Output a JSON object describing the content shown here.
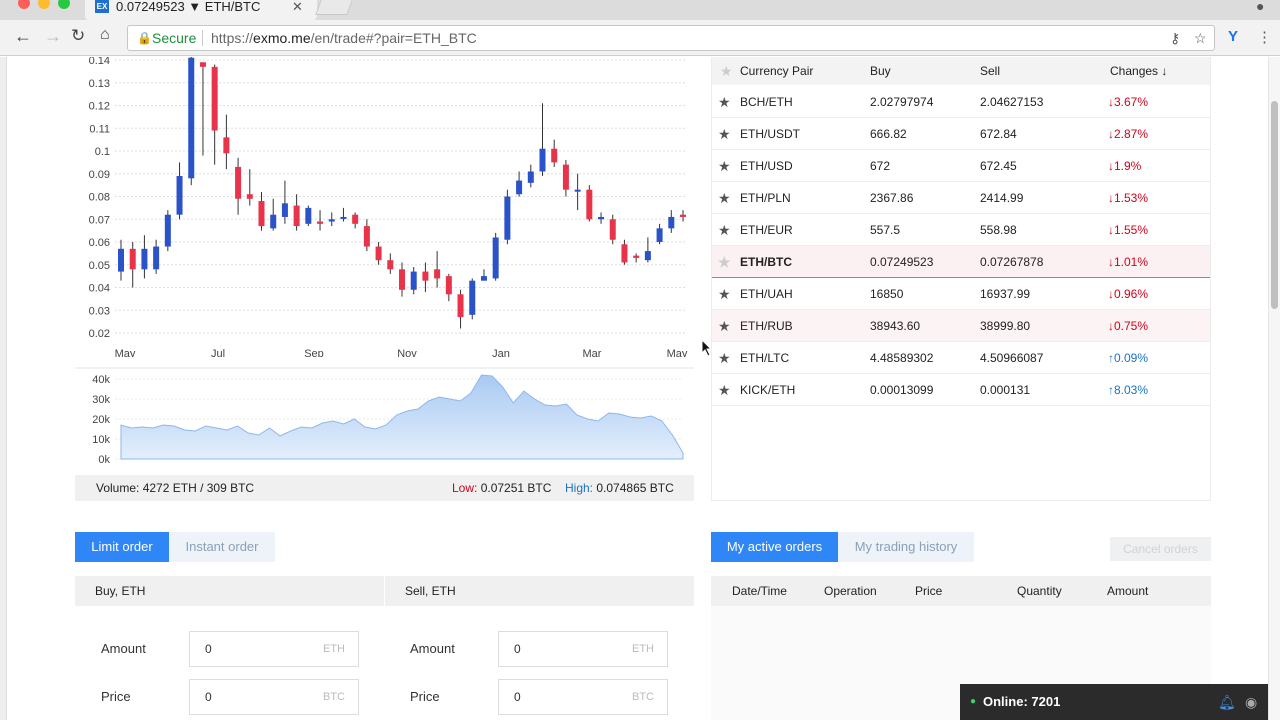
{
  "browser": {
    "tab_title": "0.07249523 ▼ ETH/BTC",
    "tab_favicon": "EX",
    "secure_label": "Secure",
    "url_scheme": "https://",
    "url_host": "exmo.me",
    "url_path": "/en/trade#?pair=ETH_BTC"
  },
  "chart_data": [
    {
      "type": "candlestick",
      "x_tick_labels": [
        "May",
        "Jul",
        "Sep",
        "Nov",
        "Jan",
        "Mar",
        "May"
      ],
      "y_tick_labels": [
        "0.14",
        "0.13",
        "0.12",
        "0.11",
        "0.1",
        "0.09",
        "0.08",
        "0.07",
        "0.06",
        "0.05",
        "0.04",
        "0.03",
        "0.02"
      ],
      "ylim": [
        0.02,
        0.14
      ],
      "grid": true,
      "up_color": "#2a52c9",
      "down_color": "#e8334a",
      "candles": [
        {
          "o": 0.047,
          "c": 0.057,
          "h": 0.061,
          "l": 0.043
        },
        {
          "o": 0.057,
          "c": 0.048,
          "h": 0.06,
          "l": 0.04
        },
        {
          "o": 0.048,
          "c": 0.057,
          "h": 0.063,
          "l": 0.044
        },
        {
          "o": 0.048,
          "c": 0.058,
          "h": 0.061,
          "l": 0.046
        },
        {
          "o": 0.058,
          "c": 0.072,
          "h": 0.074,
          "l": 0.056
        },
        {
          "o": 0.072,
          "c": 0.089,
          "h": 0.095,
          "l": 0.07
        },
        {
          "o": 0.088,
          "c": 0.141,
          "h": 0.142,
          "l": 0.085
        },
        {
          "o": 0.139,
          "c": 0.137,
          "h": 0.139,
          "l": 0.098
        },
        {
          "o": 0.137,
          "c": 0.109,
          "h": 0.138,
          "l": 0.094
        },
        {
          "o": 0.106,
          "c": 0.099,
          "h": 0.116,
          "l": 0.092
        },
        {
          "o": 0.093,
          "c": 0.079,
          "h": 0.097,
          "l": 0.072
        },
        {
          "o": 0.081,
          "c": 0.079,
          "h": 0.092,
          "l": 0.076
        },
        {
          "o": 0.078,
          "c": 0.067,
          "h": 0.082,
          "l": 0.065
        },
        {
          "o": 0.066,
          "c": 0.072,
          "h": 0.079,
          "l": 0.065
        },
        {
          "o": 0.071,
          "c": 0.077,
          "h": 0.087,
          "l": 0.068
        },
        {
          "o": 0.076,
          "c": 0.067,
          "h": 0.081,
          "l": 0.065
        },
        {
          "o": 0.068,
          "c": 0.075,
          "h": 0.076,
          "l": 0.067
        },
        {
          "o": 0.069,
          "c": 0.068,
          "h": 0.074,
          "l": 0.065
        },
        {
          "o": 0.069,
          "c": 0.07,
          "h": 0.073,
          "l": 0.067
        },
        {
          "o": 0.071,
          "c": 0.071,
          "h": 0.075,
          "l": 0.069
        },
        {
          "o": 0.072,
          "c": 0.068,
          "h": 0.073,
          "l": 0.066
        },
        {
          "o": 0.067,
          "c": 0.058,
          "h": 0.07,
          "l": 0.056
        },
        {
          "o": 0.058,
          "c": 0.052,
          "h": 0.06,
          "l": 0.05
        },
        {
          "o": 0.052,
          "c": 0.048,
          "h": 0.055,
          "l": 0.046
        },
        {
          "o": 0.048,
          "c": 0.039,
          "h": 0.051,
          "l": 0.036
        },
        {
          "o": 0.039,
          "c": 0.047,
          "h": 0.049,
          "l": 0.037
        },
        {
          "o": 0.047,
          "c": 0.043,
          "h": 0.051,
          "l": 0.038
        },
        {
          "o": 0.048,
          "c": 0.044,
          "h": 0.056,
          "l": 0.04
        },
        {
          "o": 0.045,
          "c": 0.037,
          "h": 0.046,
          "l": 0.034
        },
        {
          "o": 0.037,
          "c": 0.027,
          "h": 0.039,
          "l": 0.022
        },
        {
          "o": 0.028,
          "c": 0.043,
          "h": 0.044,
          "l": 0.026
        },
        {
          "o": 0.043,
          "c": 0.045,
          "h": 0.048,
          "l": 0.043
        },
        {
          "o": 0.044,
          "c": 0.062,
          "h": 0.064,
          "l": 0.043
        },
        {
          "o": 0.061,
          "c": 0.08,
          "h": 0.083,
          "l": 0.059
        },
        {
          "o": 0.081,
          "c": 0.087,
          "h": 0.091,
          "l": 0.08
        },
        {
          "o": 0.086,
          "c": 0.091,
          "h": 0.094,
          "l": 0.084
        },
        {
          "o": 0.091,
          "c": 0.101,
          "h": 0.121,
          "l": 0.089
        },
        {
          "o": 0.101,
          "c": 0.095,
          "h": 0.105,
          "l": 0.093
        },
        {
          "o": 0.094,
          "c": 0.083,
          "h": 0.096,
          "l": 0.08
        },
        {
          "o": 0.083,
          "c": 0.083,
          "h": 0.09,
          "l": 0.074
        },
        {
          "o": 0.083,
          "c": 0.07,
          "h": 0.085,
          "l": 0.069
        },
        {
          "o": 0.07,
          "c": 0.071,
          "h": 0.073,
          "l": 0.068
        },
        {
          "o": 0.07,
          "c": 0.061,
          "h": 0.072,
          "l": 0.059
        },
        {
          "o": 0.059,
          "c": 0.051,
          "h": 0.061,
          "l": 0.05
        },
        {
          "o": 0.054,
          "c": 0.053,
          "h": 0.055,
          "l": 0.051
        },
        {
          "o": 0.052,
          "c": 0.056,
          "h": 0.062,
          "l": 0.051
        },
        {
          "o": 0.06,
          "c": 0.066,
          "h": 0.068,
          "l": 0.059
        },
        {
          "o": 0.066,
          "c": 0.071,
          "h": 0.074,
          "l": 0.064
        },
        {
          "o": 0.072,
          "c": 0.071,
          "h": 0.074,
          "l": 0.069
        }
      ]
    },
    {
      "type": "area",
      "y_tick_labels": [
        "40k",
        "30k",
        "20k",
        "10k",
        "0k"
      ],
      "ylim": [
        0,
        40000
      ],
      "fill_color": "#a9c9f2",
      "values": [
        17000,
        15500,
        16000,
        15500,
        17000,
        16500,
        14500,
        14000,
        16500,
        15500,
        14500,
        16500,
        13000,
        12000,
        15500,
        11500,
        14000,
        16000,
        15500,
        18000,
        19000,
        17500,
        20000,
        16000,
        15000,
        17000,
        22000,
        24000,
        25000,
        29000,
        31000,
        30000,
        29000,
        33000,
        42000,
        41500,
        36000,
        28000,
        34000,
        30000,
        27000,
        26500,
        27500,
        22000,
        20000,
        19000,
        23000,
        22500,
        21000,
        20500,
        21500,
        19000,
        12000,
        3000
      ]
    }
  ],
  "chart_footer": {
    "volume_label": "Volume:",
    "volume_value": "4272 ETH / 309 BTC",
    "low_label": "Low:",
    "low_value": "0.07251 BTC",
    "high_label": "High:",
    "high_value": "0.074865 BTC"
  },
  "pairs_table": {
    "headers": {
      "pair": "Currency Pair",
      "buy": "Buy",
      "sell": "Sell",
      "changes": "Changes ↓"
    },
    "rows": [
      {
        "pair": "BCH/ETH",
        "buy": "2.02797974",
        "sell": "2.04627153",
        "change": "↓3.67%",
        "dir": "down"
      },
      {
        "pair": "ETH/USDT",
        "buy": "666.82",
        "sell": "672.84",
        "change": "↓2.87%",
        "dir": "down"
      },
      {
        "pair": "ETH/USD",
        "buy": "672",
        "sell": "672.45",
        "change": "↓1.9%",
        "dir": "down"
      },
      {
        "pair": "ETH/PLN",
        "buy": "2367.86",
        "sell": "2414.99",
        "change": "↓1.53%",
        "dir": "down"
      },
      {
        "pair": "ETH/EUR",
        "buy": "557.5",
        "sell": "558.98",
        "change": "↓1.55%",
        "dir": "down"
      },
      {
        "pair": "ETH/BTC",
        "buy": "0.07249523",
        "sell": "0.07267878",
        "change": "↓1.01%",
        "dir": "down"
      },
      {
        "pair": "ETH/UAH",
        "buy": "16850",
        "sell": "16937.99",
        "change": "↓0.96%",
        "dir": "down"
      },
      {
        "pair": "ETH/RUB",
        "buy": "38943.60",
        "sell": "38999.80",
        "change": "↓0.75%",
        "dir": "down"
      },
      {
        "pair": "ETH/LTC",
        "buy": "4.48589302",
        "sell": "4.50966087",
        "change": "↑0.09%",
        "dir": "up"
      },
      {
        "pair": "KICK/ETH",
        "buy": "0.00013099",
        "sell": "0.000131",
        "change": "↑8.03%",
        "dir": "up"
      }
    ]
  },
  "order_tabs": {
    "limit": "Limit order",
    "instant": "Instant order"
  },
  "orders_tabs": {
    "active": "My active orders",
    "history": "My trading history",
    "cancel": "Cancel orders"
  },
  "buy_form": {
    "title": "Buy, ETH",
    "amount_label": "Amount",
    "amount_value": "0",
    "amount_unit": "ETH",
    "price_label": "Price",
    "price_value": "0",
    "price_unit": "BTC"
  },
  "sell_form": {
    "title": "Sell, ETH",
    "amount_label": "Amount",
    "amount_value": "0",
    "amount_unit": "ETH",
    "price_label": "Price",
    "price_value": "0",
    "price_unit": "BTC"
  },
  "orders_table": {
    "headers": [
      "Date/Time",
      "Operation",
      "Price",
      "Quantity",
      "Amount"
    ]
  },
  "online": {
    "label": "Online: 7201"
  }
}
